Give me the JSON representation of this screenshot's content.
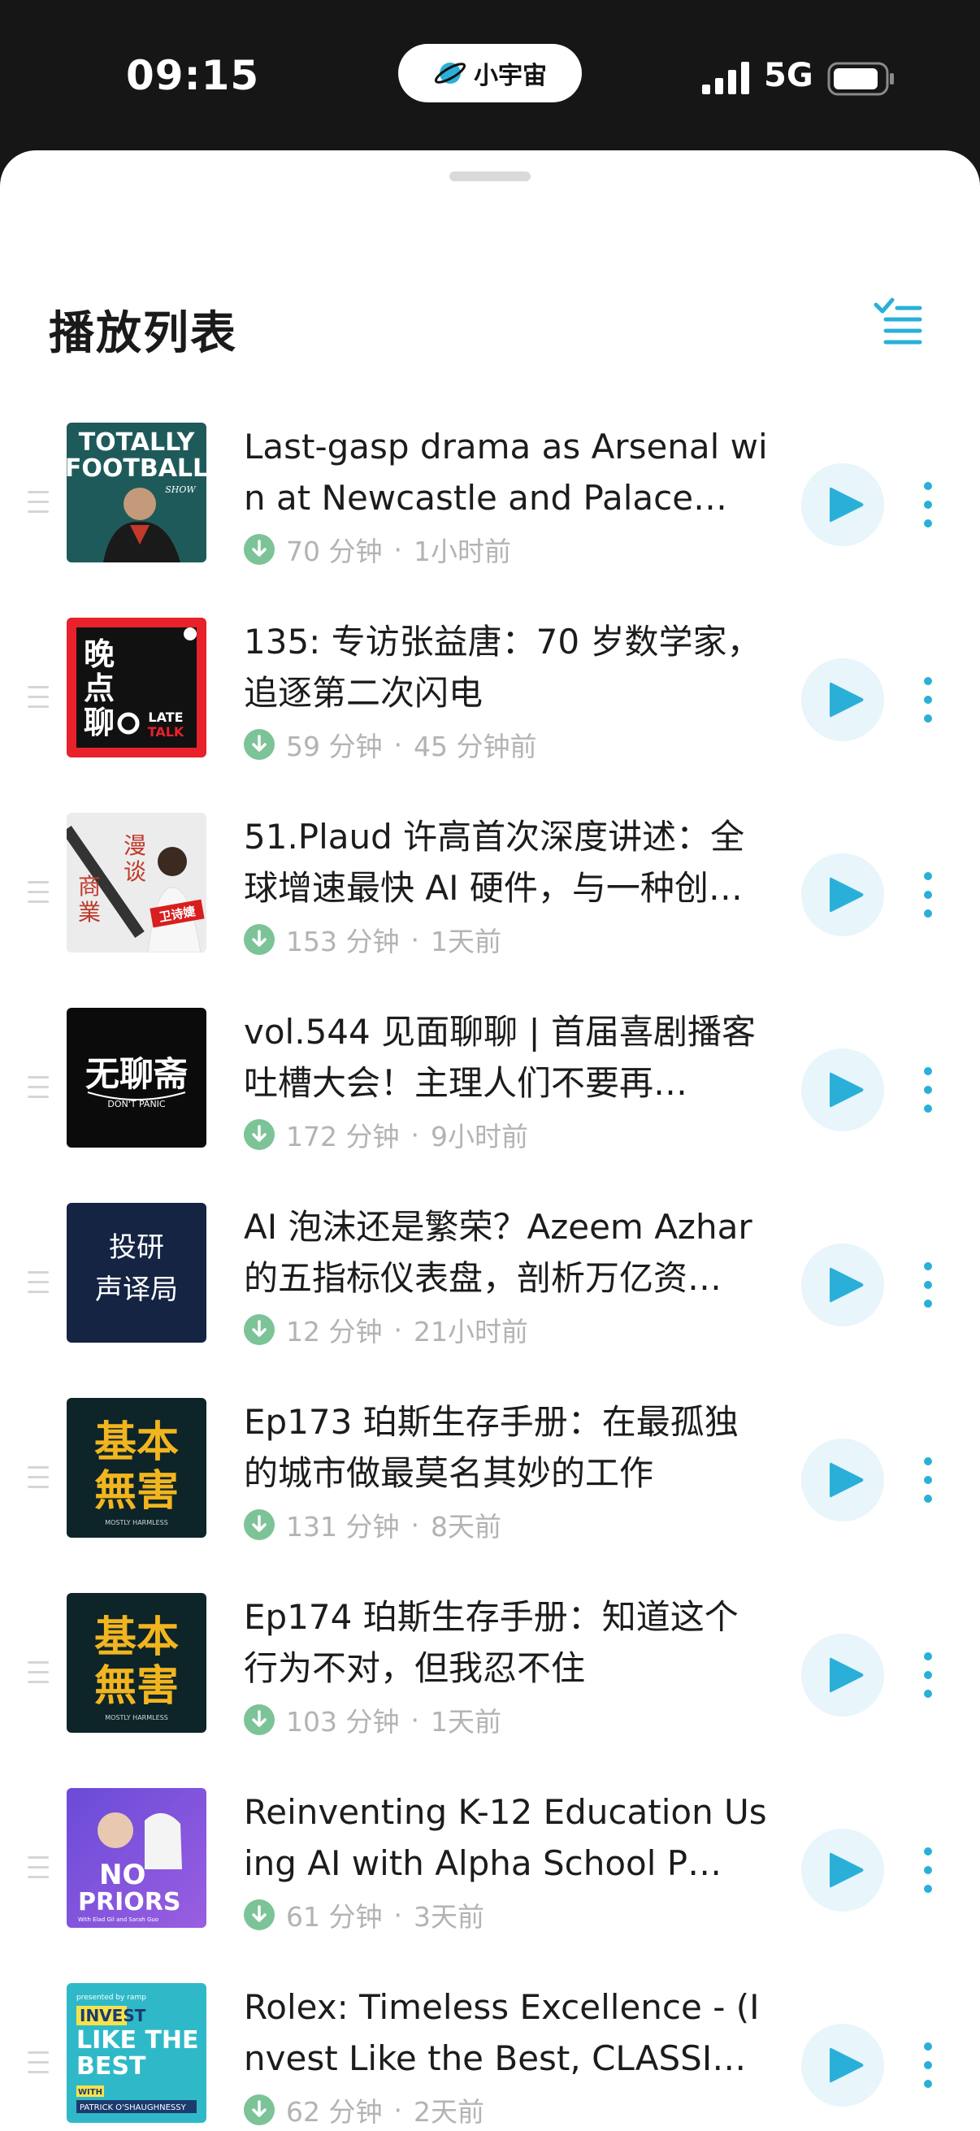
{
  "status_bar": {
    "time": "09:15",
    "island_label": "小宇宙",
    "network": "5G"
  },
  "sheet": {
    "title": "播放列表"
  },
  "colors": {
    "accent": "#2ab0d8",
    "download_green": "#7cc397",
    "play_bg": "#e8f5fb"
  },
  "episodes": [
    {
      "title": "Last-gasp drama as Arsenal win at Newcastle and Palace…",
      "duration": "70 分钟",
      "age": "1小时前",
      "cover": "totally-football"
    },
    {
      "title": "135: 专访张益唐：70 岁数学家，追逐第二次闪电",
      "duration": "59 分钟",
      "age": "45 分钟前",
      "cover": "late-talk"
    },
    {
      "title": "51.Plaud 许高首次深度讲述：全球增速最快 AI 硬件，与一种创…",
      "duration": "153 分钟",
      "age": "1天前",
      "cover": "man-tan-shang-ye"
    },
    {
      "title": "vol.544 见面聊聊 | 首届喜剧播客吐槽大会！主理人们不要再…",
      "duration": "172 分钟",
      "age": "9小时前",
      "cover": "dont-panic"
    },
    {
      "title": "AI 泡沫还是繁荣？Azeem Azhar 的五指标仪表盘，剖析万亿资…",
      "duration": "12 分钟",
      "age": "21小时前",
      "cover": "tou-yan"
    },
    {
      "title": "Ep173 珀斯生存手册：在最孤独的城市做最莫名其妙的工作",
      "duration": "131 分钟",
      "age": "8天前",
      "cover": "mostly-harmless"
    },
    {
      "title": "Ep174 珀斯生存手册：知道这个行为不对，但我忍不住",
      "duration": "103 分钟",
      "age": "1天前",
      "cover": "mostly-harmless"
    },
    {
      "title": "Reinventing K-12 Education Using AI with Alpha School P…",
      "duration": "61 分钟",
      "age": "3天前",
      "cover": "no-priors"
    },
    {
      "title": "Rolex: Timeless Excellence - (Invest Like the Best, CLASSI…",
      "duration": "62 分钟",
      "age": "2天前",
      "cover": "invest-like-the-best"
    }
  ],
  "cover_text": {
    "totally_football": [
      "TOTALLY",
      "FOOTBALL",
      "SHOW"
    ],
    "late_talk": [
      "晚",
      "点",
      "聊",
      "LATE",
      "TALK"
    ],
    "man_tan": [
      "漫",
      "谈",
      "商",
      "業",
      "卫诗婕"
    ],
    "dont_panic": [
      "无聊斋",
      "DON'T PANIC"
    ],
    "tou_yan": [
      "投研",
      "声译局"
    ],
    "mostly_harmless": [
      "基本",
      "無害",
      "MOSTLY HARMLESS"
    ],
    "no_priors": [
      "NO",
      "PRIORS",
      "With Elad Gil and Sarah Guo"
    ],
    "invest": [
      "presented by ramp",
      "INVEST",
      "LIKE THE",
      "BEST",
      "WITH",
      "PATRICK O'SHAUGHNESSY"
    ]
  }
}
